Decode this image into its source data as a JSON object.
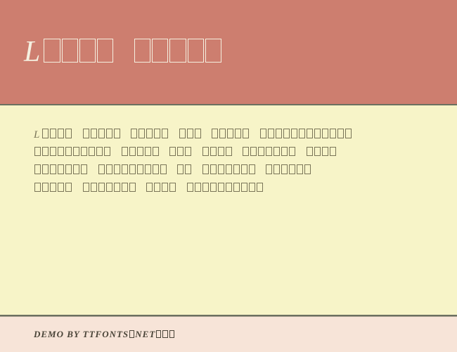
{
  "header": {
    "title_first": "L",
    "title_boxes_word1": 4,
    "title_boxes_word2": 5
  },
  "body": {
    "line1": {
      "lead": "L",
      "groups": [
        4,
        5,
        5,
        3,
        5,
        12
      ]
    },
    "line2": {
      "groups": [
        10,
        5,
        3,
        4,
        7,
        4
      ]
    },
    "line3": {
      "groups": [
        7,
        9,
        2,
        7,
        6
      ]
    },
    "line4": {
      "groups": [
        5,
        7,
        4,
        10
      ]
    }
  },
  "footer": {
    "prefix": "DEMO BY TTFONTS",
    "mid_box": 1,
    "mid_text": "NET",
    "tail_boxes": 3
  }
}
